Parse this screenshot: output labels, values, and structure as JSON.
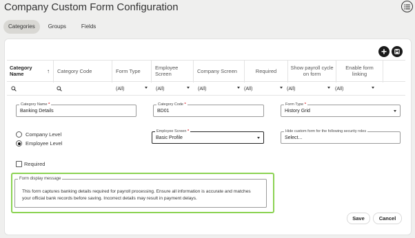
{
  "page": {
    "title": "Company Custom Form Configuration"
  },
  "tabs": [
    {
      "label": "Categories",
      "active": true
    },
    {
      "label": "Groups",
      "active": false
    },
    {
      "label": "Fields",
      "active": false
    }
  ],
  "grid": {
    "columns": [
      {
        "label": "Category Name",
        "sort": "↑"
      },
      {
        "label": "Category Code"
      },
      {
        "label": "Form Type"
      },
      {
        "label": "Employee Screen"
      },
      {
        "label": "Company Screen"
      },
      {
        "label": "Required"
      },
      {
        "label": "Show payroll cycle on form"
      },
      {
        "label": "Enable form linking"
      }
    ],
    "filters": {
      "form_type": "(All)",
      "employee_screen": "(All)",
      "company_screen": "(All)",
      "required": "(All)",
      "show_payroll": "(All)",
      "enable_linking": "(All)"
    }
  },
  "form": {
    "category_name": {
      "label": "Category Name",
      "required_mark": "*",
      "value": "Banking Details"
    },
    "category_code": {
      "label": "Category Code",
      "required_mark": "*",
      "value": "BD01"
    },
    "form_type": {
      "label": "Form Type",
      "required_mark": "*",
      "value": "History Grid"
    },
    "level_options": [
      {
        "label": "Company Level",
        "selected": false
      },
      {
        "label": "Employee Level",
        "selected": true
      }
    ],
    "employee_screen": {
      "label": "Employee Screen",
      "required_mark": "*",
      "value": "Basic Profile"
    },
    "hide_roles": {
      "label": "Hide custom form for the following security roles",
      "placeholder": "Select..."
    },
    "required_checkbox": {
      "label": "Required",
      "checked": false
    },
    "display_message": {
      "label": "Form display message",
      "value": "This form captures banking details required for payroll processing. Ensure all information is accurate and matches your official bank records before saving. Incorrect details may result in payment delays."
    }
  },
  "actions": {
    "save_label": "Save",
    "cancel_label": "Cancel"
  },
  "colors": {
    "highlight": "#8ad251",
    "required": "#d8242c",
    "tab_active": "#d9d8d4"
  }
}
